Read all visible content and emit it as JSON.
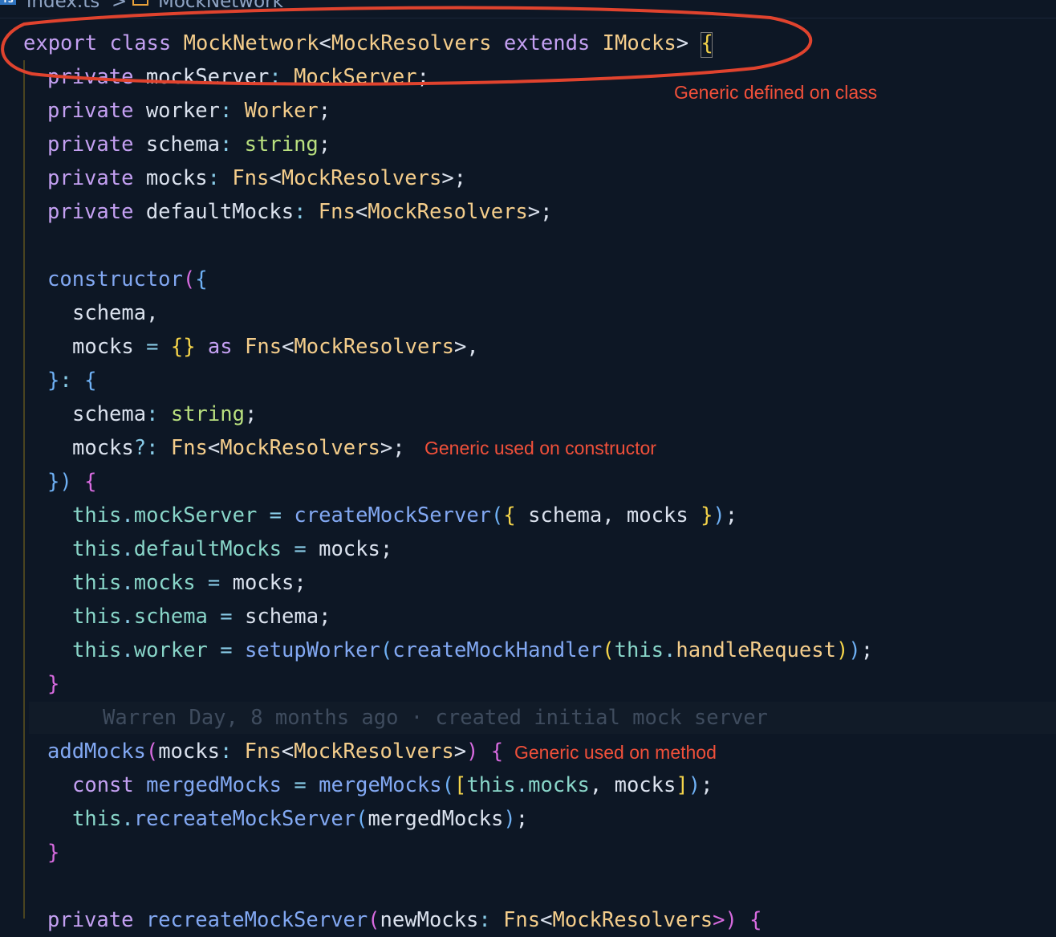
{
  "breadcrumb": {
    "file_badge": "TS",
    "file": "index.ts",
    "separator": ">",
    "symbol": "MockNetwork",
    "icon": "class-symbol-icon"
  },
  "code": {
    "l1": [
      "export",
      "class",
      "MockNetwork",
      "<",
      "MockResolvers",
      "extends",
      "IMocks",
      ">",
      "{"
    ],
    "l2": [
      "private",
      "mockServer",
      ":",
      "MockServer",
      ";"
    ],
    "l3": [
      "private",
      "worker",
      ":",
      "Worker",
      ";"
    ],
    "l4": [
      "private",
      "schema",
      ":",
      "string",
      ";"
    ],
    "l5": [
      "private",
      "mocks",
      ":",
      "Fns",
      "<",
      "MockResolvers",
      ">;"
    ],
    "l6": [
      "private",
      "defaultMocks",
      ":",
      "Fns",
      "<",
      "MockResolvers",
      ">;"
    ],
    "l8": [
      "constructor",
      "(",
      "{"
    ],
    "l9": [
      "schema",
      ","
    ],
    "l10": [
      "mocks",
      "=",
      "{}",
      "as",
      "Fns",
      "<",
      "MockResolvers",
      ">,"
    ],
    "l11": [
      "}",
      ":",
      "{"
    ],
    "l12": [
      "schema",
      ":",
      "string",
      ";"
    ],
    "l13": [
      "mocks",
      "?:",
      "Fns",
      "<",
      "MockResolvers",
      ">;"
    ],
    "l14": [
      "})",
      "{"
    ],
    "l15": [
      "this",
      ".",
      "mockServer",
      "=",
      "createMockServer",
      "(",
      "{",
      "schema, mocks",
      "}",
      ")",
      ";"
    ],
    "l16": [
      "this",
      ".",
      "defaultMocks",
      "=",
      "mocks;"
    ],
    "l17": [
      "this",
      ".",
      "mocks",
      "=",
      "mocks;"
    ],
    "l18": [
      "this",
      ".",
      "schema",
      "=",
      "schema;"
    ],
    "l19": [
      "this",
      ".",
      "worker",
      "=",
      "setupWorker",
      "(",
      "createMockHandler",
      "(",
      "this",
      ".",
      "handleRequest",
      ")",
      ")",
      ";"
    ],
    "l20": [
      "}"
    ],
    "blame": "Warren Day, 8 months ago · created initial mock server",
    "l22": [
      "addMocks",
      "(",
      "mocks",
      ":",
      "Fns",
      "<",
      "MockResolvers",
      ">",
      ")",
      "{"
    ],
    "l23": [
      "const",
      "mergedMocks",
      "=",
      "mergeMocks",
      "(",
      "[",
      "this",
      ".",
      "mocks",
      ", mocks",
      "]",
      ")",
      ";"
    ],
    "l24": [
      "this",
      ".",
      "recreateMockServer",
      "(",
      "mergedMocks",
      ")",
      ";"
    ],
    "l25": [
      "}"
    ],
    "l27": [
      "private",
      "recreateMockServer",
      "(",
      "newMocks",
      ":",
      "Fns",
      "<",
      "MockResolvers",
      ">)",
      "{"
    ]
  },
  "annotations": {
    "class": "Generic defined on class",
    "constructor": "Generic used on constructor",
    "method": "Generic used on method",
    "color": "#f0503a"
  },
  "theme": {
    "background": "#0d1725",
    "keyword": "#c4a0f2",
    "class": "#f4cd8b",
    "function": "#82a8f2",
    "property": "#89d6c9",
    "string": "#b9e07f"
  }
}
